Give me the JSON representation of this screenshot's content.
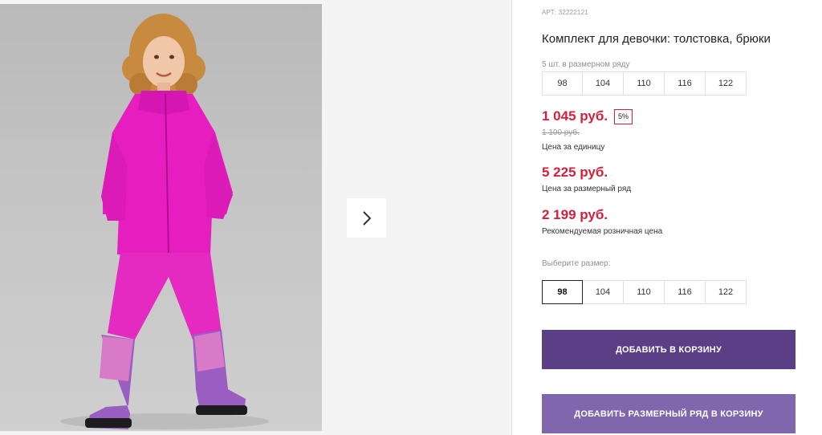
{
  "gallery": {
    "photo_alt": "Девочка в розовом флисовом комплекте",
    "next_icon": "chevron-right-icon"
  },
  "product": {
    "sku_label": "АРТ:",
    "sku_value": "32222121",
    "title": "Комплект для девочки: толстовка, брюки",
    "pack_note": "5 шт. в размерном ряду",
    "pack_sizes": [
      "98",
      "104",
      "110",
      "116",
      "122"
    ]
  },
  "prices": {
    "unit_price": "1 045 руб.",
    "discount": "5%",
    "old_price": "1 100 руб.",
    "unit_label": "Цена за единицу",
    "row_price": "5 225 руб.",
    "row_label": "Цена за размерный ряд",
    "retail_price": "2 199 руб.",
    "retail_label": "Рекомендуемая розничная цена",
    "accent_color": "#d41f3a"
  },
  "size_select": {
    "label": "Выберите размер:",
    "options": [
      "98",
      "104",
      "110",
      "116",
      "122"
    ],
    "selected": "98"
  },
  "buttons": {
    "add_to_cart": "ДОБАВИТЬ В КОРЗИНУ",
    "add_row_to_cart": "ДОБАВИТЬ РАЗМЕРНЫЙ РЯД В КОРЗИНУ",
    "primary_color": "#5a3f86",
    "secondary_color": "#7f66ad"
  }
}
